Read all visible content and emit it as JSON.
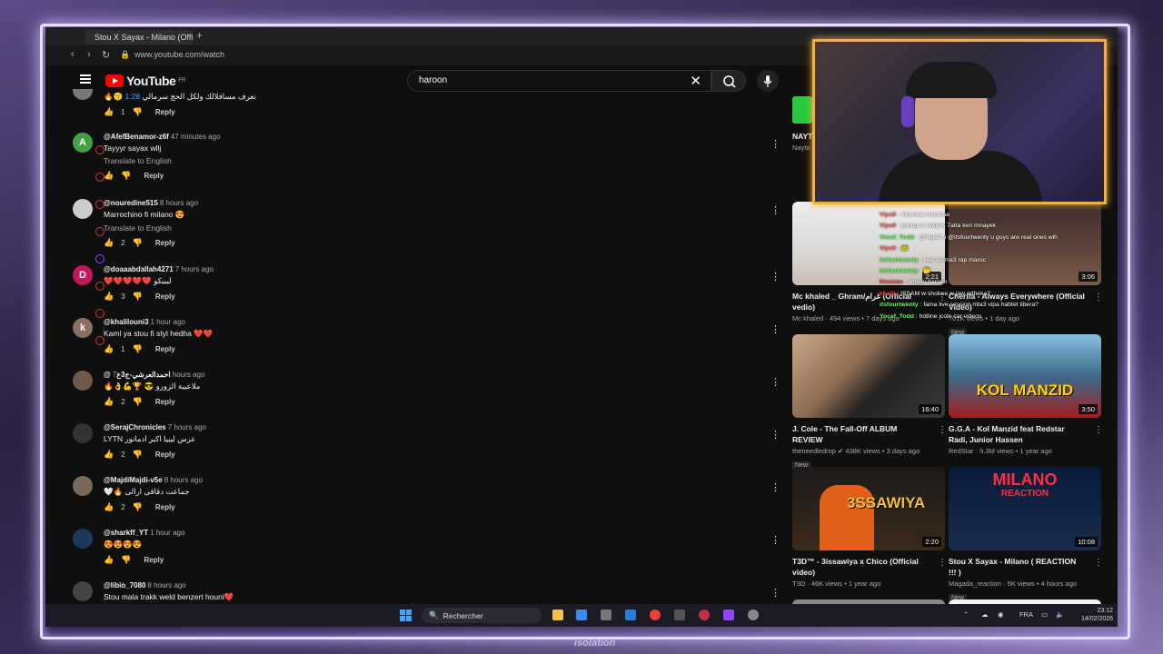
{
  "browser": {
    "tab_title": "Stou X Sayax - Milano (Offi",
    "new_tab": "+",
    "url": "www.youtube.com/watch"
  },
  "youtube": {
    "logo_text": "YouTube",
    "country": "FR",
    "search_value": "haroon",
    "clear": "✕"
  },
  "comments": [
    {
      "handle": "",
      "ago": "",
      "text": "🔥😙 نعرف مسافلالك ولكل الحج سرمالي",
      "timestamp": "1:28",
      "translate": "",
      "likes": "1",
      "avatar_letter": "",
      "avatar_color": "#777777"
    },
    {
      "handle": "@AfefBenamor-z6f",
      "ago": "47 minutes ago",
      "text": "Tayyyr sayax wllj",
      "translate": "Translate to English",
      "likes": "",
      "avatar_letter": "A",
      "avatar_color": "#43a047"
    },
    {
      "handle": "@nouredine515",
      "ago": "8 hours ago",
      "text": "Marrochino fi milano 😍",
      "translate": "Translate to English",
      "likes": "2",
      "avatar_letter": "",
      "avatar_color": "#cccccc"
    },
    {
      "handle": "@doaaabdallah4271",
      "ago": "7 hours ago",
      "text": "❤️❤️❤️❤️❤️ ليبيكو",
      "translate": "",
      "likes": "3",
      "avatar_letter": "D",
      "avatar_color": "#c2185b"
    },
    {
      "handle": "@khalilouni3",
      "ago": "1 hour ago",
      "text": "Kaml ya stou fi styl hedha ❤️❤️",
      "translate": "",
      "likes": "1",
      "avatar_letter": "k",
      "avatar_color": "#8d6e63"
    },
    {
      "handle": "@احمدالعرشي-ج3ع",
      "ago": "7 hours ago",
      "text": "🔥👌💪🏆 😎 ملاعيبة الزورو",
      "translate": "",
      "likes": "2",
      "avatar_letter": "",
      "avatar_color": "#6d5a4a"
    },
    {
      "handle": "@SerajChronicles",
      "ago": "7 hours ago",
      "text": "LYTN عرس ليبيا اكبر ادمانور",
      "translate": "",
      "likes": "2",
      "avatar_letter": "",
      "avatar_color": "#333333"
    },
    {
      "handle": "@MajdiMajdi-v5e",
      "ago": "8 hours ago",
      "text": "🤍🔥 جماعت دقاقى ارالى",
      "translate": "",
      "likes": "2",
      "avatar_letter": "",
      "avatar_color": "#7a6a5a"
    },
    {
      "handle": "@sharkff_YT",
      "ago": "1 hour ago",
      "text": "😍😍😍😍",
      "translate": "",
      "likes": "",
      "avatar_letter": "",
      "avatar_color": "#1e3a5a"
    },
    {
      "handle": "@libio_7080",
      "ago": "8 hours ago",
      "text": "Stou mala trakk weld benzert houni❤️",
      "translate": "",
      "likes": "",
      "avatar_letter": "",
      "avatar_color": "#444444"
    }
  ],
  "reply_label": "Reply",
  "sidebar": {
    "top_partial": {
      "title": "NAYT",
      "channel": "Nayto"
    },
    "videos": [
      {
        "title": "Mc khaled _ Ghram/غرام (Official vedio)",
        "channel": "Mc khaled",
        "meta": "494 views • 7 days ago",
        "duration": "2:21",
        "badge": ""
      },
      {
        "title": "Cherifa - Always Everywhere (Official Video)",
        "channel": "",
        "meta": "701K views • 1 day ago",
        "duration": "3:06",
        "badge": "New"
      },
      {
        "title": "J. Cole - The Fall-Off ALBUM REVIEW",
        "channel": "theneedledrop",
        "meta": "438K views • 3 days ago",
        "duration": "16:40",
        "badge": "New"
      },
      {
        "title": "G.G.A - Kol Manzid feat Redstar Radi, Junior Hassen",
        "channel": "RedStar",
        "meta": "5.3M views • 1 year ago",
        "duration": "3:50",
        "badge": ""
      },
      {
        "title": "T3D™ - 3issawiya x Chico (Official video)",
        "channel": "T3D",
        "meta": "46K views • 1 year ago",
        "duration": "2:20",
        "badge": ""
      },
      {
        "title": "Stou X Sayax - Milano ( REACTION !!! )",
        "channel": "Magada_reaction",
        "meta": "5K views • 4 hours ago",
        "duration": "10:08",
        "badge": "New"
      }
    ],
    "thumb_text": {
      "kol": "KOL MANZID",
      "issawiya": "3SSAWIYA",
      "milano": "MILANO",
      "reaction": "REACTION"
    }
  },
  "chat": [
    {
      "user": "Vipa0",
      "msg": "nikomha nikomha",
      "color": "u1"
    },
    {
      "user": "Vipa0",
      "msg": "young rz swipes 7atta ken mnayek",
      "color": "u1"
    },
    {
      "user": "Yocef_Todd",
      "msg": "@Vipa0 o @itsfourtwenty u guys are real ones wlh",
      "color": "u2"
    },
    {
      "user": "Vipa0",
      "msg": "🐸",
      "color": "u1"
    },
    {
      "user": "itsfourtwenty",
      "msg": "kais tasma3 rap maroc",
      "color": "u2"
    },
    {
      "user": "itsfourtwenty",
      "msg": "🤔",
      "color": "u2"
    },
    {
      "user": "Nounou",
      "msg": "sma3y haroon",
      "color": "u3"
    },
    {
      "user": "khalil",
      "msg": "ISSAM w shobee w jaw edheka?",
      "color": "u3"
    },
    {
      "user": "itsfourtwenty",
      "msg": "fama live session mta3 vipa habtet libera?",
      "color": "u2"
    },
    {
      "user": "Yocef_Todd",
      "msg": "hotline jcole car videos",
      "color": "u2"
    }
  ],
  "taskbar": {
    "search_label": "Rechercher",
    "lang": "FRA",
    "time": "23:12",
    "date": "14/02/2026"
  },
  "watermark": "isolation"
}
